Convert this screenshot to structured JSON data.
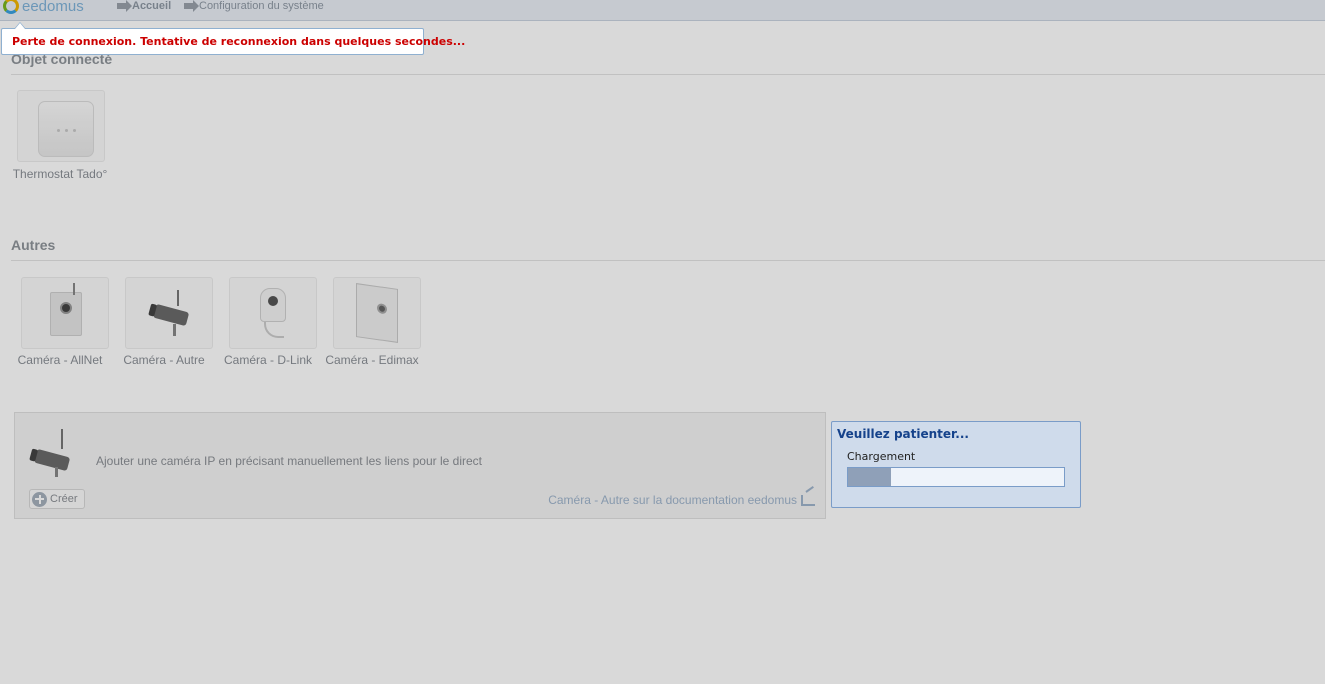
{
  "header": {
    "logo_text": "eedomus",
    "breadcrumbs": [
      "Accueil",
      "Configuration du système"
    ]
  },
  "sections": {
    "connected": {
      "title": "Objet connecté",
      "items": [
        {
          "label": "Thermostat Tado°",
          "icon": "thermostat-icon"
        }
      ]
    },
    "others": {
      "title": "Autres",
      "items": [
        {
          "label": "Caméra - AllNet",
          "icon": "camera-allnet-icon"
        },
        {
          "label": "Caméra - Autre",
          "icon": "camera-bullet-icon"
        },
        {
          "label": "Caméra - D-Link",
          "icon": "camera-dlink-icon"
        },
        {
          "label": "Caméra - Edimax",
          "icon": "camera-edimax-icon"
        }
      ]
    }
  },
  "create_panel": {
    "description": "Ajouter une caméra IP en précisant manuellement les liens pour le direct",
    "create_label": "Créer",
    "doc_link": "Caméra - Autre sur la documentation eedomus"
  },
  "notification": {
    "text": "Perte de connexion. Tentative de reconnexion dans quelques secondes..."
  },
  "loading": {
    "title": "Veuillez patienter...",
    "label": "Chargement",
    "progress": 0.2
  },
  "colors": {
    "error_text": "#cc0000",
    "dialog_title": "#15428b",
    "dialog_bg": "#cfdbeb"
  }
}
